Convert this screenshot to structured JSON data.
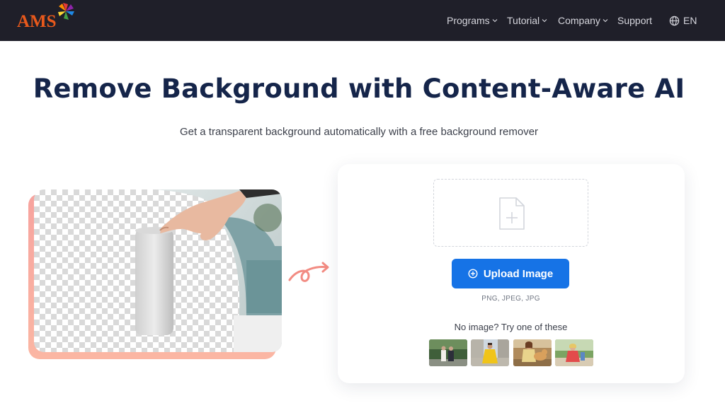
{
  "brand": {
    "logo_text": "AMS"
  },
  "nav": {
    "items": [
      {
        "label": "Programs",
        "has_dropdown": true
      },
      {
        "label": "Tutorial",
        "has_dropdown": true
      },
      {
        "label": "Company",
        "has_dropdown": true
      },
      {
        "label": "Support",
        "has_dropdown": false
      }
    ],
    "language": {
      "label": "EN",
      "icon": "globe-icon"
    }
  },
  "hero": {
    "title": "Remove Background with Content-Aware AI",
    "subtitle": "Get a transparent background automatically with a free background remover"
  },
  "uploader": {
    "dropzone_icon": "file-plus-icon",
    "button_label": "Upload Image",
    "button_icon": "plus-circle-icon",
    "formats": "PNG, JPEG, JPG",
    "samples_prompt": "No image? Try one of these",
    "samples": [
      {
        "icon": "sample-photo-couple"
      },
      {
        "icon": "sample-photo-yellow-dress"
      },
      {
        "icon": "sample-photo-woman-with-dog"
      },
      {
        "icon": "sample-photo-child-in-park"
      }
    ]
  },
  "colors": {
    "nav_bg": "#1f1f29",
    "title": "#15254a",
    "primary": "#1673e6",
    "logo_orange": "#e8591c",
    "accent_coral": "#f7a39e"
  }
}
